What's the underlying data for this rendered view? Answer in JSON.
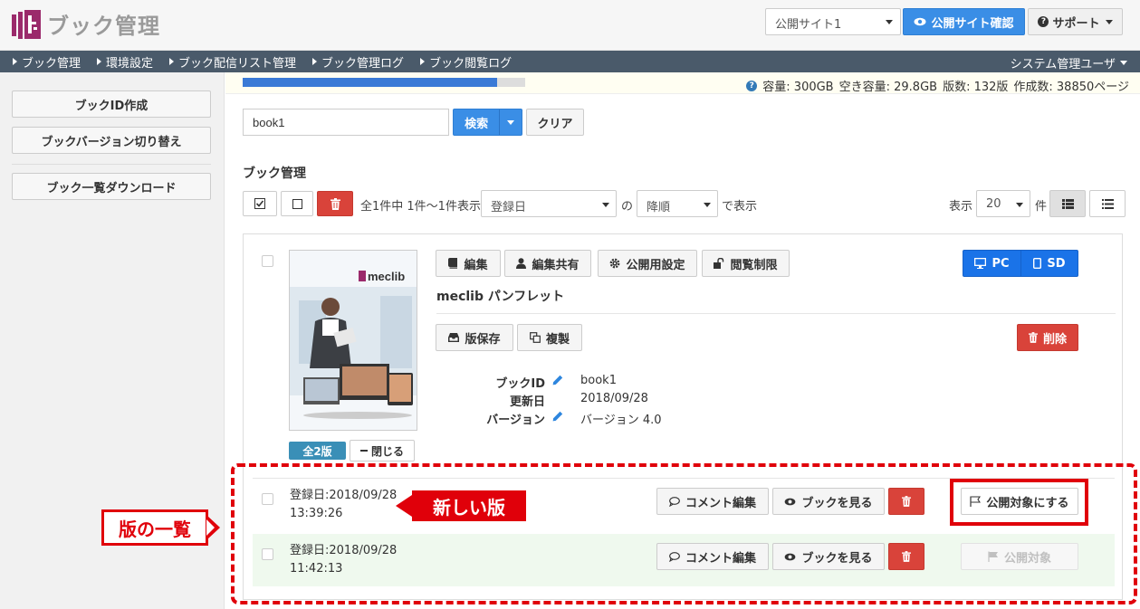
{
  "header": {
    "app_title": "ブック管理",
    "site_select_value": "公開サイト1",
    "public_site_button": "公開サイト確認",
    "support_button": "サポート"
  },
  "nav": {
    "items": [
      "ブック管理",
      "環境設定",
      "ブック配信リスト管理",
      "ブック管理ログ",
      "ブック閲覧ログ"
    ],
    "user_menu": "システム管理ユーザ"
  },
  "sidebar": {
    "buttons": [
      "ブックID作成",
      "ブックバージョン切り替え",
      "ブック一覧ダウンロード"
    ]
  },
  "info": {
    "capacity_text": "容量: 300GB",
    "free_text": "空き容量: 29.8GB",
    "editions_text": "版数: 132版",
    "created_text": "作成数: 38850ページ",
    "usage_fraction": 0.9
  },
  "search": {
    "value": "book1",
    "search_button": "検索",
    "clear_button": "クリア"
  },
  "list": {
    "section_title": "ブック管理",
    "count_text": "全1件中 1件～1件表示",
    "sort_field": "登録日",
    "of_text": "の",
    "sort_order": "降順",
    "show_text": "で表示",
    "per_page_label": "表示",
    "per_page_value": "20",
    "per_page_unit": "件"
  },
  "book": {
    "title": "meclib パンフレット",
    "thumb_brand": "meclib",
    "buttons": {
      "edit": "編集",
      "share": "編集共有",
      "publish_settings": "公開用設定",
      "access_limit": "閲覧制限",
      "pc": "PC",
      "sd": "SD",
      "save_version": "版保存",
      "duplicate": "複製",
      "delete": "削除"
    },
    "meta": {
      "book_id_label": "ブックID",
      "book_id_value": "book1",
      "updated_label": "更新日",
      "updated_value": "2018/09/28",
      "version_label": "バージョン",
      "version_value": "バージョン 4.0"
    },
    "versions_badge": "全2版",
    "close_button": "閉じる"
  },
  "versions": [
    {
      "date_line": "登録日:2018/09/28",
      "time_line": "13:39:26",
      "comment_button": "コメント編集",
      "view_button": "ブックを見る",
      "publish_button": "公開対象にする"
    },
    {
      "date_line": "登録日:2018/09/28",
      "time_line": "11:42:13",
      "comment_button": "コメント編集",
      "view_button": "ブックを見る",
      "publish_button": "公開対象"
    }
  ],
  "annotations": {
    "version_list_label": "版の一覧",
    "new_version_label": "新しい版"
  },
  "colors": {
    "primary": "#3a8ee6",
    "danger": "#d9433a",
    "nav_bg": "#4a5a6a",
    "annotation": "#e0000a",
    "logo": "#9b2a6b"
  }
}
